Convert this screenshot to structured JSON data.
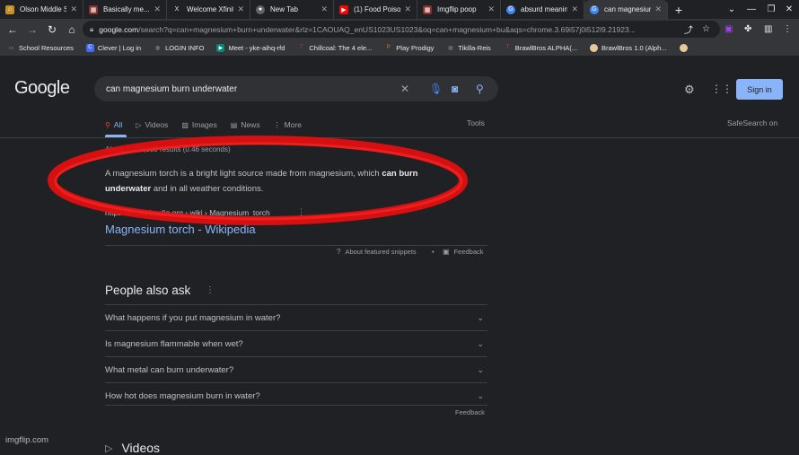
{
  "browser": {
    "tabs": [
      {
        "label": "Olson Middle Sch",
        "icon": "school-icon",
        "color": "#c58f2a"
      },
      {
        "label": "Basically me...",
        "icon": "imgflip-icon",
        "color": "#8b2f2f"
      },
      {
        "label": "Welcome Xfinity",
        "icon": "x-icon",
        "color": "#111111"
      },
      {
        "label": "New Tab",
        "icon": "chrome-icon",
        "color": "#5f6368"
      },
      {
        "label": "(1) Food Poisoning",
        "icon": "youtube-icon",
        "color": "#ff0000"
      },
      {
        "label": "Imgflip poop",
        "icon": "imgflip-icon",
        "color": "#8b2f2f"
      },
      {
        "label": "absurd meaning",
        "icon": "google-icon",
        "color": "#4285f4"
      },
      {
        "label": "can magnesium",
        "icon": "google-icon",
        "color": "#4285f4"
      }
    ],
    "new_tab": "+",
    "url_host": "google.com",
    "url_rest": "/search?q=can+magnesium+burn+underwater&rlz=1CAOUAQ_enUS1023US1023&oq=can+magnesium+bu&aqs=chrome.3.69i57j0i512l9.21923...",
    "bookmarks": [
      {
        "label": "School Resources",
        "icon": "folder-icon",
        "color": "#9aa0a6"
      },
      {
        "label": "Clever | Log in",
        "icon": "clever-icon",
        "color": "#436cf2"
      },
      {
        "label": "LOGIN INFO",
        "icon": "globe-icon",
        "color": "#9aa0a6"
      },
      {
        "label": "Meet - yke-aihq-rfd",
        "icon": "meet-icon",
        "color": "#00897b"
      },
      {
        "label": "Chillcoal: The 4 ele...",
        "icon": "pin-icon",
        "color": "#c0392b"
      },
      {
        "label": "Play Prodigy",
        "icon": "prodigy-icon",
        "color": "#e8710a"
      },
      {
        "label": "Tikilla-Reis",
        "icon": "globe-icon",
        "color": "#9aa0a6"
      },
      {
        "label": "BrawlBros ALPHA(...",
        "icon": "pin-icon",
        "color": "#c0392b"
      },
      {
        "label": "BrawlBros 1.0 (Alph...",
        "icon": "egg-icon",
        "color": "#e6c99a"
      }
    ]
  },
  "search": {
    "logo": "Google",
    "query": "can magnesium burn underwater",
    "signin": "Sign in",
    "tabs": [
      {
        "label": "All",
        "icon": "search-icon"
      },
      {
        "label": "Videos",
        "icon": "video-icon"
      },
      {
        "label": "Images",
        "icon": "image-icon"
      },
      {
        "label": "News",
        "icon": "news-icon"
      },
      {
        "label": "More",
        "icon": "more-icon"
      }
    ],
    "tools": "Tools",
    "safesearch": "SafeSearch on",
    "results_count": "About 1,400,000 results (0.46 seconds)",
    "snippet_pre": "A magnesium torch is a bright light source made from magnesium, which ",
    "snippet_bold1": "can burn",
    "snippet_bold2": "underwater",
    "snippet_post": " and in all weather conditions.",
    "cite": "https://en.wikipedia.org › wiki › Magnesium_torch",
    "result_title": "Magnesium torch - Wikipedia",
    "about_snippets": "About featured snippets",
    "feedback": "Feedback",
    "paa_title": "People also ask",
    "paa": [
      "What happens if you put magnesium in water?",
      "Is magnesium flammable when wet?",
      "What metal can burn underwater?",
      "How hot does magnesium burn in water?"
    ],
    "feedback2": "Feedback",
    "videos_heading": "Videos"
  },
  "annotation": {
    "color": "#e01010"
  },
  "watermark": "imgflip.com"
}
